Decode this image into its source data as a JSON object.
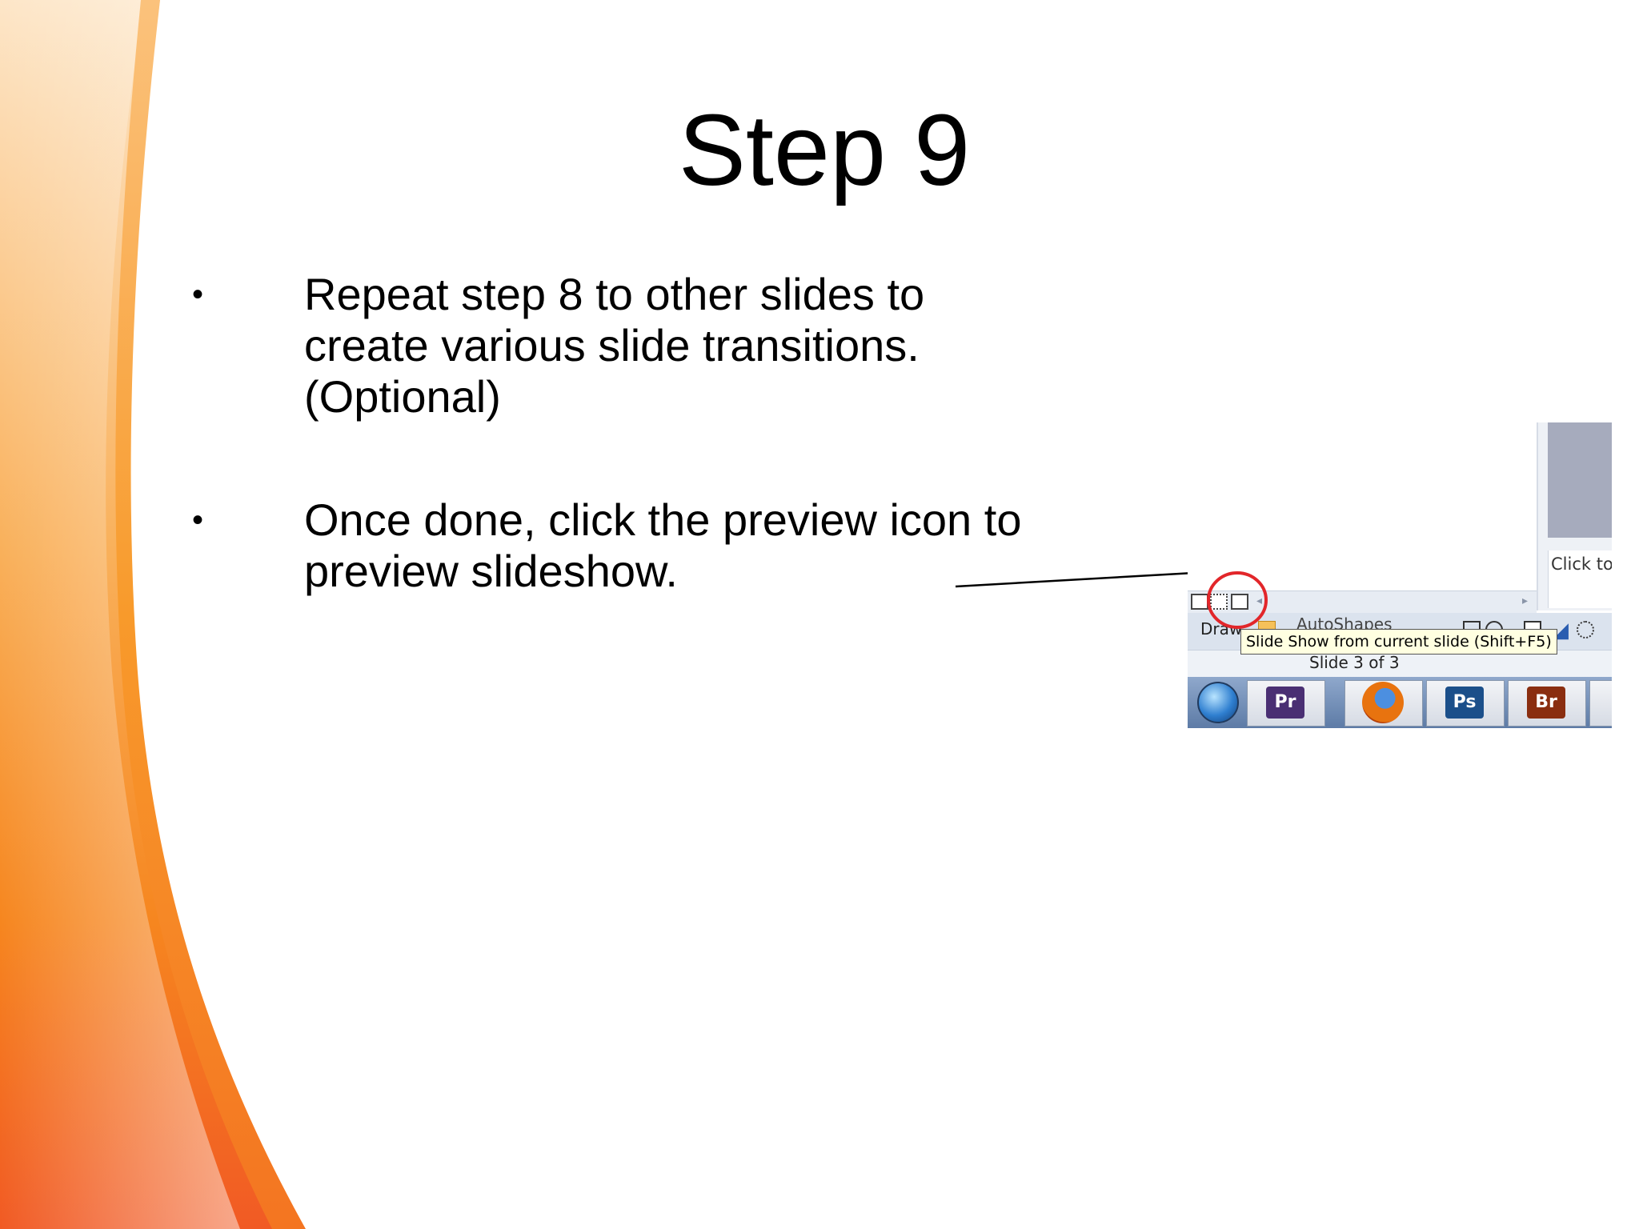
{
  "slide": {
    "title": "Step 9",
    "bullets": [
      {
        "marker": "•",
        "lines": [
          "Repeat step 8 to other slides to",
          "create various slide transitions.",
          "(Optional)"
        ]
      },
      {
        "marker": "•",
        "lines": [
          "Once done, click the preview icon to",
          "preview slideshow."
        ]
      }
    ]
  },
  "screenshot": {
    "notes_placeholder": "Click to",
    "draw_label": "Draw",
    "autoshapes_label": "AutoShapes",
    "tooltip": "Slide Show from current slide (Shift+F5)",
    "status": "Slide 3 of 3",
    "taskbar_apps": [
      {
        "label": "Pr",
        "color": "#4a2f73"
      },
      {
        "label": "firefox-icon",
        "color": "#e8730f"
      },
      {
        "label": "Ps",
        "color": "#1b4f8a"
      },
      {
        "label": "Br",
        "color": "#8a2e10"
      }
    ]
  },
  "colors": {
    "accent_orange": "#f7901e",
    "highlight_circle": "#e2262a"
  }
}
